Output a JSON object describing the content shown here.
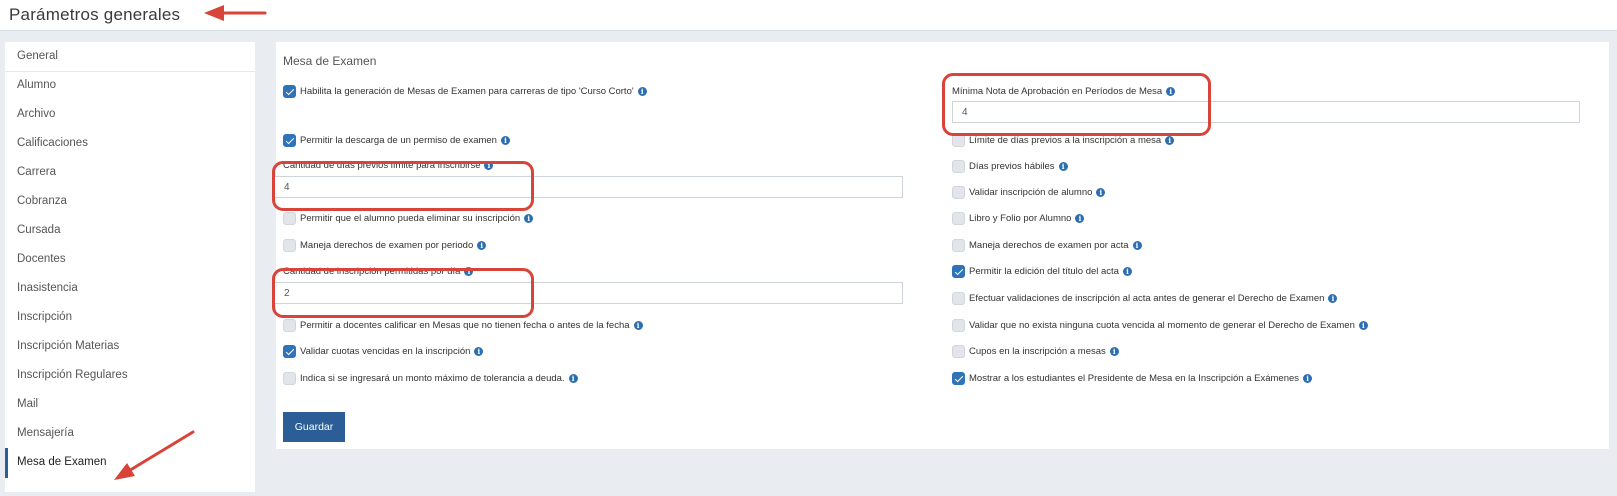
{
  "header": {
    "title": "Parámetros generales"
  },
  "sidebar": {
    "items": [
      {
        "label": "General"
      },
      {
        "label": "Alumno"
      },
      {
        "label": "Archivo"
      },
      {
        "label": "Calificaciones"
      },
      {
        "label": "Carrera"
      },
      {
        "label": "Cobranza"
      },
      {
        "label": "Cursada"
      },
      {
        "label": "Docentes"
      },
      {
        "label": "Inasistencia"
      },
      {
        "label": "Inscripción"
      },
      {
        "label": "Inscripción Materias"
      },
      {
        "label": "Inscripción Regulares"
      },
      {
        "label": "Mail"
      },
      {
        "label": "Mensajería"
      },
      {
        "label": "Mesa de Examen",
        "active": true
      }
    ]
  },
  "main": {
    "section_title": "Mesa de Examen",
    "left": {
      "habilita_curso_corto": {
        "label": "Habilita la generación de Mesas de Examen para carreras de tipo 'Curso Corto'",
        "checked": true
      },
      "permitir_descarga_permiso": {
        "label": "Permitir la descarga de un permiso de examen",
        "checked": true
      },
      "dias_previos_limite": {
        "label": "Cantidad de días previos límite para inscribirse",
        "value": "4"
      },
      "alumno_eliminar_inscripcion": {
        "label": "Permitir que el alumno pueda eliminar su inscripción",
        "checked": false
      },
      "derechos_por_periodo": {
        "label": "Maneja derechos de examen por periodo",
        "checked": false
      },
      "inscripciones_por_dia": {
        "label": "Cantidad de inscripción permitidas por día",
        "value": "2"
      },
      "docentes_calificar_sin_fecha": {
        "label": "Permitir a docentes calificar en Mesas que no tienen fecha o antes de la fecha",
        "checked": false
      },
      "validar_cuotas_vencidas": {
        "label": "Validar cuotas vencidas en la inscripción",
        "checked": true
      },
      "monto_maximo_tolerancia": {
        "label": "Indica si se ingresará un monto máximo de tolerancia a deuda.",
        "checked": false
      }
    },
    "right": {
      "minima_nota_aprobacion": {
        "label": "Mínima Nota de Aprobación en Períodos de Mesa",
        "value": "4"
      },
      "limite_dias_previos": {
        "label": "Límite de días previos a la inscripción a mesa",
        "checked": false
      },
      "dias_previos_habiles": {
        "label": "Días previos hábiles",
        "checked": false
      },
      "validar_inscripcion_alumno": {
        "label": "Validar inscripción de alumno",
        "checked": false
      },
      "libro_folio_por_alumno": {
        "label": "Libro y Folio por Alumno",
        "checked": false
      },
      "derechos_por_acta": {
        "label": "Maneja derechos de examen por acta",
        "checked": false
      },
      "edicion_titulo_acta": {
        "label": "Permitir la edición del título del acta",
        "checked": true
      },
      "validaciones_antes_derecho": {
        "label": "Efectuar validaciones de inscripción al acta antes de generar el Derecho de Examen",
        "checked": false
      },
      "validar_sin_cuota_vencida": {
        "label": "Validar que no exista ninguna cuota vencida al momento de generar el Derecho de Examen",
        "checked": false
      },
      "cupos_inscripcion_mesas": {
        "label": "Cupos en la inscripción a mesas",
        "checked": false
      },
      "mostrar_presidente_mesa": {
        "label": "Mostrar a los estudiantes el Presidente de Mesa en la Inscripción a Exámenes",
        "checked": true
      }
    },
    "save_label": "Guardar"
  },
  "icons": {
    "info": "info-circle-icon",
    "check": "check-icon"
  },
  "colors": {
    "accent": "#2b5d97",
    "checkbox_checked": "#2f73b8",
    "annotation": "#d9443a"
  }
}
